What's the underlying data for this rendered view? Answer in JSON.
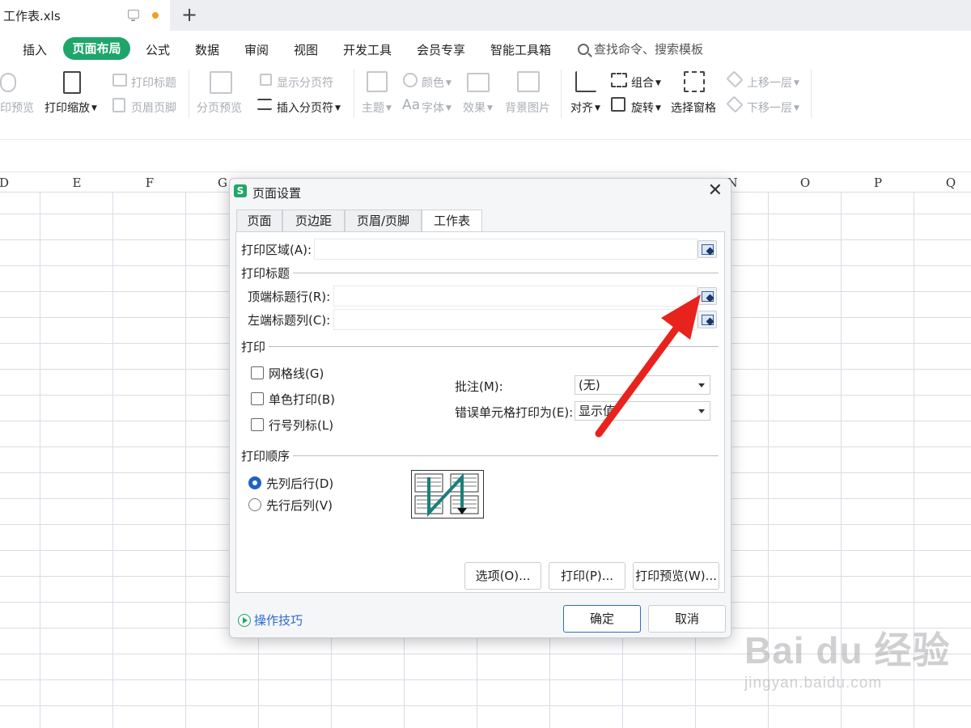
{
  "file_tab": {
    "title": "工作表.xls"
  },
  "menu": {
    "items": [
      "插入",
      "页面布局",
      "公式",
      "数据",
      "审阅",
      "视图",
      "开发工具",
      "会员专享",
      "智能工具箱"
    ],
    "active": "页面布局",
    "search_placeholder": "查找命令、搜索模板"
  },
  "toolbar": {
    "print_preview": "印预览",
    "print_scale": "打印缩放",
    "print_title": "打印标题",
    "header_footer": "页眉页脚",
    "page_break_preview": "分页预览",
    "show_page_break": "显示分页符",
    "insert_page_break": "插入分页符",
    "theme": "主题",
    "color": "颜色",
    "font": "字体",
    "effect": "效果",
    "background": "背景图片",
    "align": "对齐",
    "group": "组合",
    "rotate": "旋转",
    "selection_pane": "选择窗格",
    "bring_forward": "上移一层",
    "send_backward": "下移一层"
  },
  "sheet": {
    "columns": [
      "D",
      "E",
      "F",
      "G",
      "N",
      "O",
      "P",
      "Q"
    ]
  },
  "dialog": {
    "title": "页面设置",
    "logo": "S",
    "tabs": [
      "页面",
      "页边距",
      "页眉/页脚",
      "工作表"
    ],
    "active_tab": "工作表",
    "print_area_label": "打印区域(A):",
    "print_area_value": "",
    "print_titles_section": "打印标题",
    "top_rows_label": "顶端标题行(R):",
    "top_rows_value": "",
    "left_cols_label": "左端标题列(C):",
    "left_cols_value": "",
    "print_section": "打印",
    "gridlines_label": "网格线(G)",
    "gridlines_checked": false,
    "mono_label": "单色打印(B)",
    "mono_checked": false,
    "rowcol_label": "行号列标(L)",
    "rowcol_checked": false,
    "comments_label": "批注(M):",
    "comments_value": "(无)",
    "errors_label": "错误单元格打印为(E):",
    "errors_value": "显示值",
    "order_section": "打印顺序",
    "order_down_then_over": "先列后行(D)",
    "order_over_then_down": "先行后列(V)",
    "order_selected": "先列后行(D)",
    "options_button": "选项(O)...",
    "print_button": "打印(P)...",
    "preview_button": "打印预览(W)...",
    "ok_button": "确定",
    "cancel_button": "取消",
    "tips_link": "操作技巧"
  },
  "watermark": {
    "brand": "Bai  du 经验",
    "url": "jingyan.baidu.com"
  },
  "colors": {
    "accent_green": "#1ea56b",
    "annotation_arrow": "#e8231d",
    "radio_blue": "#1d63c6"
  }
}
